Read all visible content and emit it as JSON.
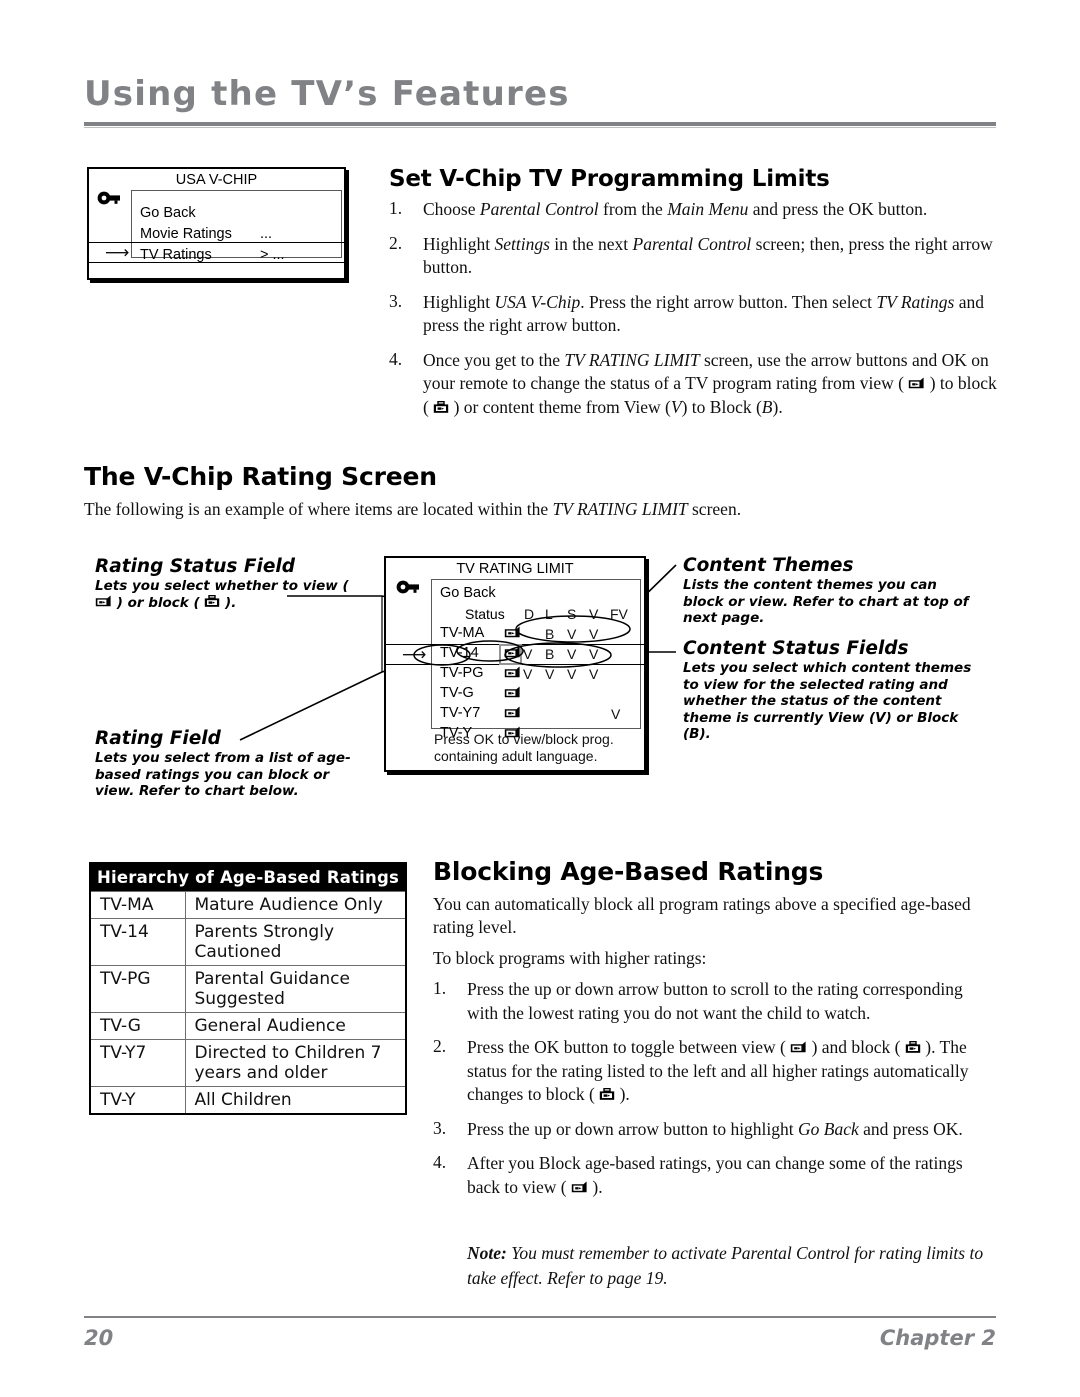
{
  "header": {
    "title": "Using the TV’s Features"
  },
  "footer": {
    "page_number": "20",
    "chapter": "Chapter 2"
  },
  "usa_vchip_menu": {
    "title": "USA V-CHIP",
    "key_icon": "key-icon",
    "rows": [
      {
        "label": "Go Back",
        "value": ""
      },
      {
        "label": "Movie Ratings",
        "value": "..."
      },
      {
        "label": "TV Ratings",
        "value": "> ...",
        "selected": true
      }
    ],
    "cursor_icon": "right-arrow-icon"
  },
  "section1": {
    "heading": "Set V-Chip TV Programming Limits",
    "steps": [
      {
        "num": "1.",
        "html": "Choose <i>Parental Control</i> from the <i>Main Menu</i> and press the OK button."
      },
      {
        "num": "2.",
        "html": "Highlight <i>Settings</i> in the next <i>Parental Control</i> screen; then, press the right arrow button."
      },
      {
        "num": "3.",
        "html": "Highlight <i>USA V-Chip</i>. Press the right arrow button. Then select <i>TV Ratings</i> and press the right arrow button."
      },
      {
        "num": "4.",
        "html": "Once you get to the <i>TV RATING LIMIT</i> screen, use the arrow buttons and OK on your remote to change the status of a TV program rating from view ( @VIEW@ ) to block ( @BLOCK@ ) or content theme from View (<i>V</i>) to Block (<i>B</i>)."
      }
    ]
  },
  "section2": {
    "heading": "The V-Chip Rating Screen",
    "intro": "The following is an example of where items are located within the <i>TV RATING LIMIT</i> screen."
  },
  "rating_limit_screen": {
    "title": "TV RATING LIMIT",
    "key_icon": "key-icon",
    "go_back": "Go Back",
    "status_label": "Status",
    "theme_columns": [
      "D",
      "L",
      "S",
      "V",
      "FV"
    ],
    "rows": [
      {
        "rating": "TV-MA",
        "status_icon": "view-icon",
        "themes": [
          "",
          "B",
          "V",
          "V",
          ""
        ]
      },
      {
        "rating": "TV-14",
        "status_icon": "view-icon",
        "themes": [
          "V",
          "B",
          "V",
          "V",
          ""
        ],
        "selected": true
      },
      {
        "rating": "TV-PG",
        "status_icon": "view-icon",
        "themes": [
          "V",
          "V",
          "V",
          "V",
          ""
        ]
      },
      {
        "rating": "TV-G",
        "status_icon": "view-icon",
        "themes": [
          "",
          "",
          "",
          "",
          ""
        ]
      },
      {
        "rating": "TV-Y7",
        "status_icon": "view-icon",
        "themes": [
          "",
          "",
          "",
          "",
          "V"
        ]
      },
      {
        "rating": "TV-Y",
        "status_icon": "view-icon",
        "themes": [
          "",
          "",
          "",
          "",
          ""
        ]
      }
    ],
    "footer_line1": "Press OK to view/block prog.",
    "footer_line2": "containing adult language.",
    "cursor_icon": "right-arrow-icon"
  },
  "callouts": {
    "rating_status_field": {
      "title": "Rating Status Field",
      "body": "Lets you select whether to view ( @VIEW@ ) or block ( @BLOCK@ )."
    },
    "rating_field": {
      "title": "Rating Field",
      "body": "Lets you select from a list of age-based ratings you can block or view. Refer to chart below."
    },
    "content_themes": {
      "title": "Content Themes",
      "body": "Lists the content themes you can block or view. Refer to chart at top of next page."
    },
    "content_status_fields": {
      "title": "Content Status Fields",
      "body": "Lets you select which content themes to view for the selected rating and whether the status of the content theme is currently View (V) or Block (B)."
    }
  },
  "hierarchy_table": {
    "header": "Hierarchy of Age-Based Ratings",
    "rows": [
      {
        "code": "TV-MA",
        "desc": "Mature Audience Only"
      },
      {
        "code": "TV-14",
        "desc": "Parents Strongly Cautioned"
      },
      {
        "code": "TV-PG",
        "desc": "Parental Guidance Suggested"
      },
      {
        "code": "TV-G",
        "desc": "General Audience"
      },
      {
        "code": "TV-Y7",
        "desc": "Directed to Children 7 years and older"
      },
      {
        "code": "TV-Y",
        "desc": "All Children"
      }
    ]
  },
  "section3": {
    "heading": "Blocking Age-Based Ratings",
    "para1": "You can automatically block all program ratings above a specified age-based rating level.",
    "para2": "To block programs with higher ratings:",
    "steps": [
      {
        "num": "1.",
        "html": "Press the up or down arrow button to scroll to the rating corresponding with the lowest rating you do not want the child to watch."
      },
      {
        "num": "2.",
        "html": "Press the OK button to toggle between view ( @VIEW@ ) and block ( @BLOCK@ ). The status for the rating listed to the left and all higher ratings automatically changes to block ( @BLOCK@ )."
      },
      {
        "num": "3.",
        "html": "Press the up or down arrow button to highlight <i>Go Back</i> and press OK."
      },
      {
        "num": "4.",
        "html": "After you Block age-based ratings, you can change some of the ratings back to view ( @VIEW@ )."
      }
    ],
    "note_label": "Note:",
    "note_text": "You must remember to activate Parental Control for rating limits to take effect. Refer to page 19."
  },
  "colors": {
    "header_gray": "#808285",
    "rule_gray": "#808285",
    "text_black": "#111111"
  }
}
